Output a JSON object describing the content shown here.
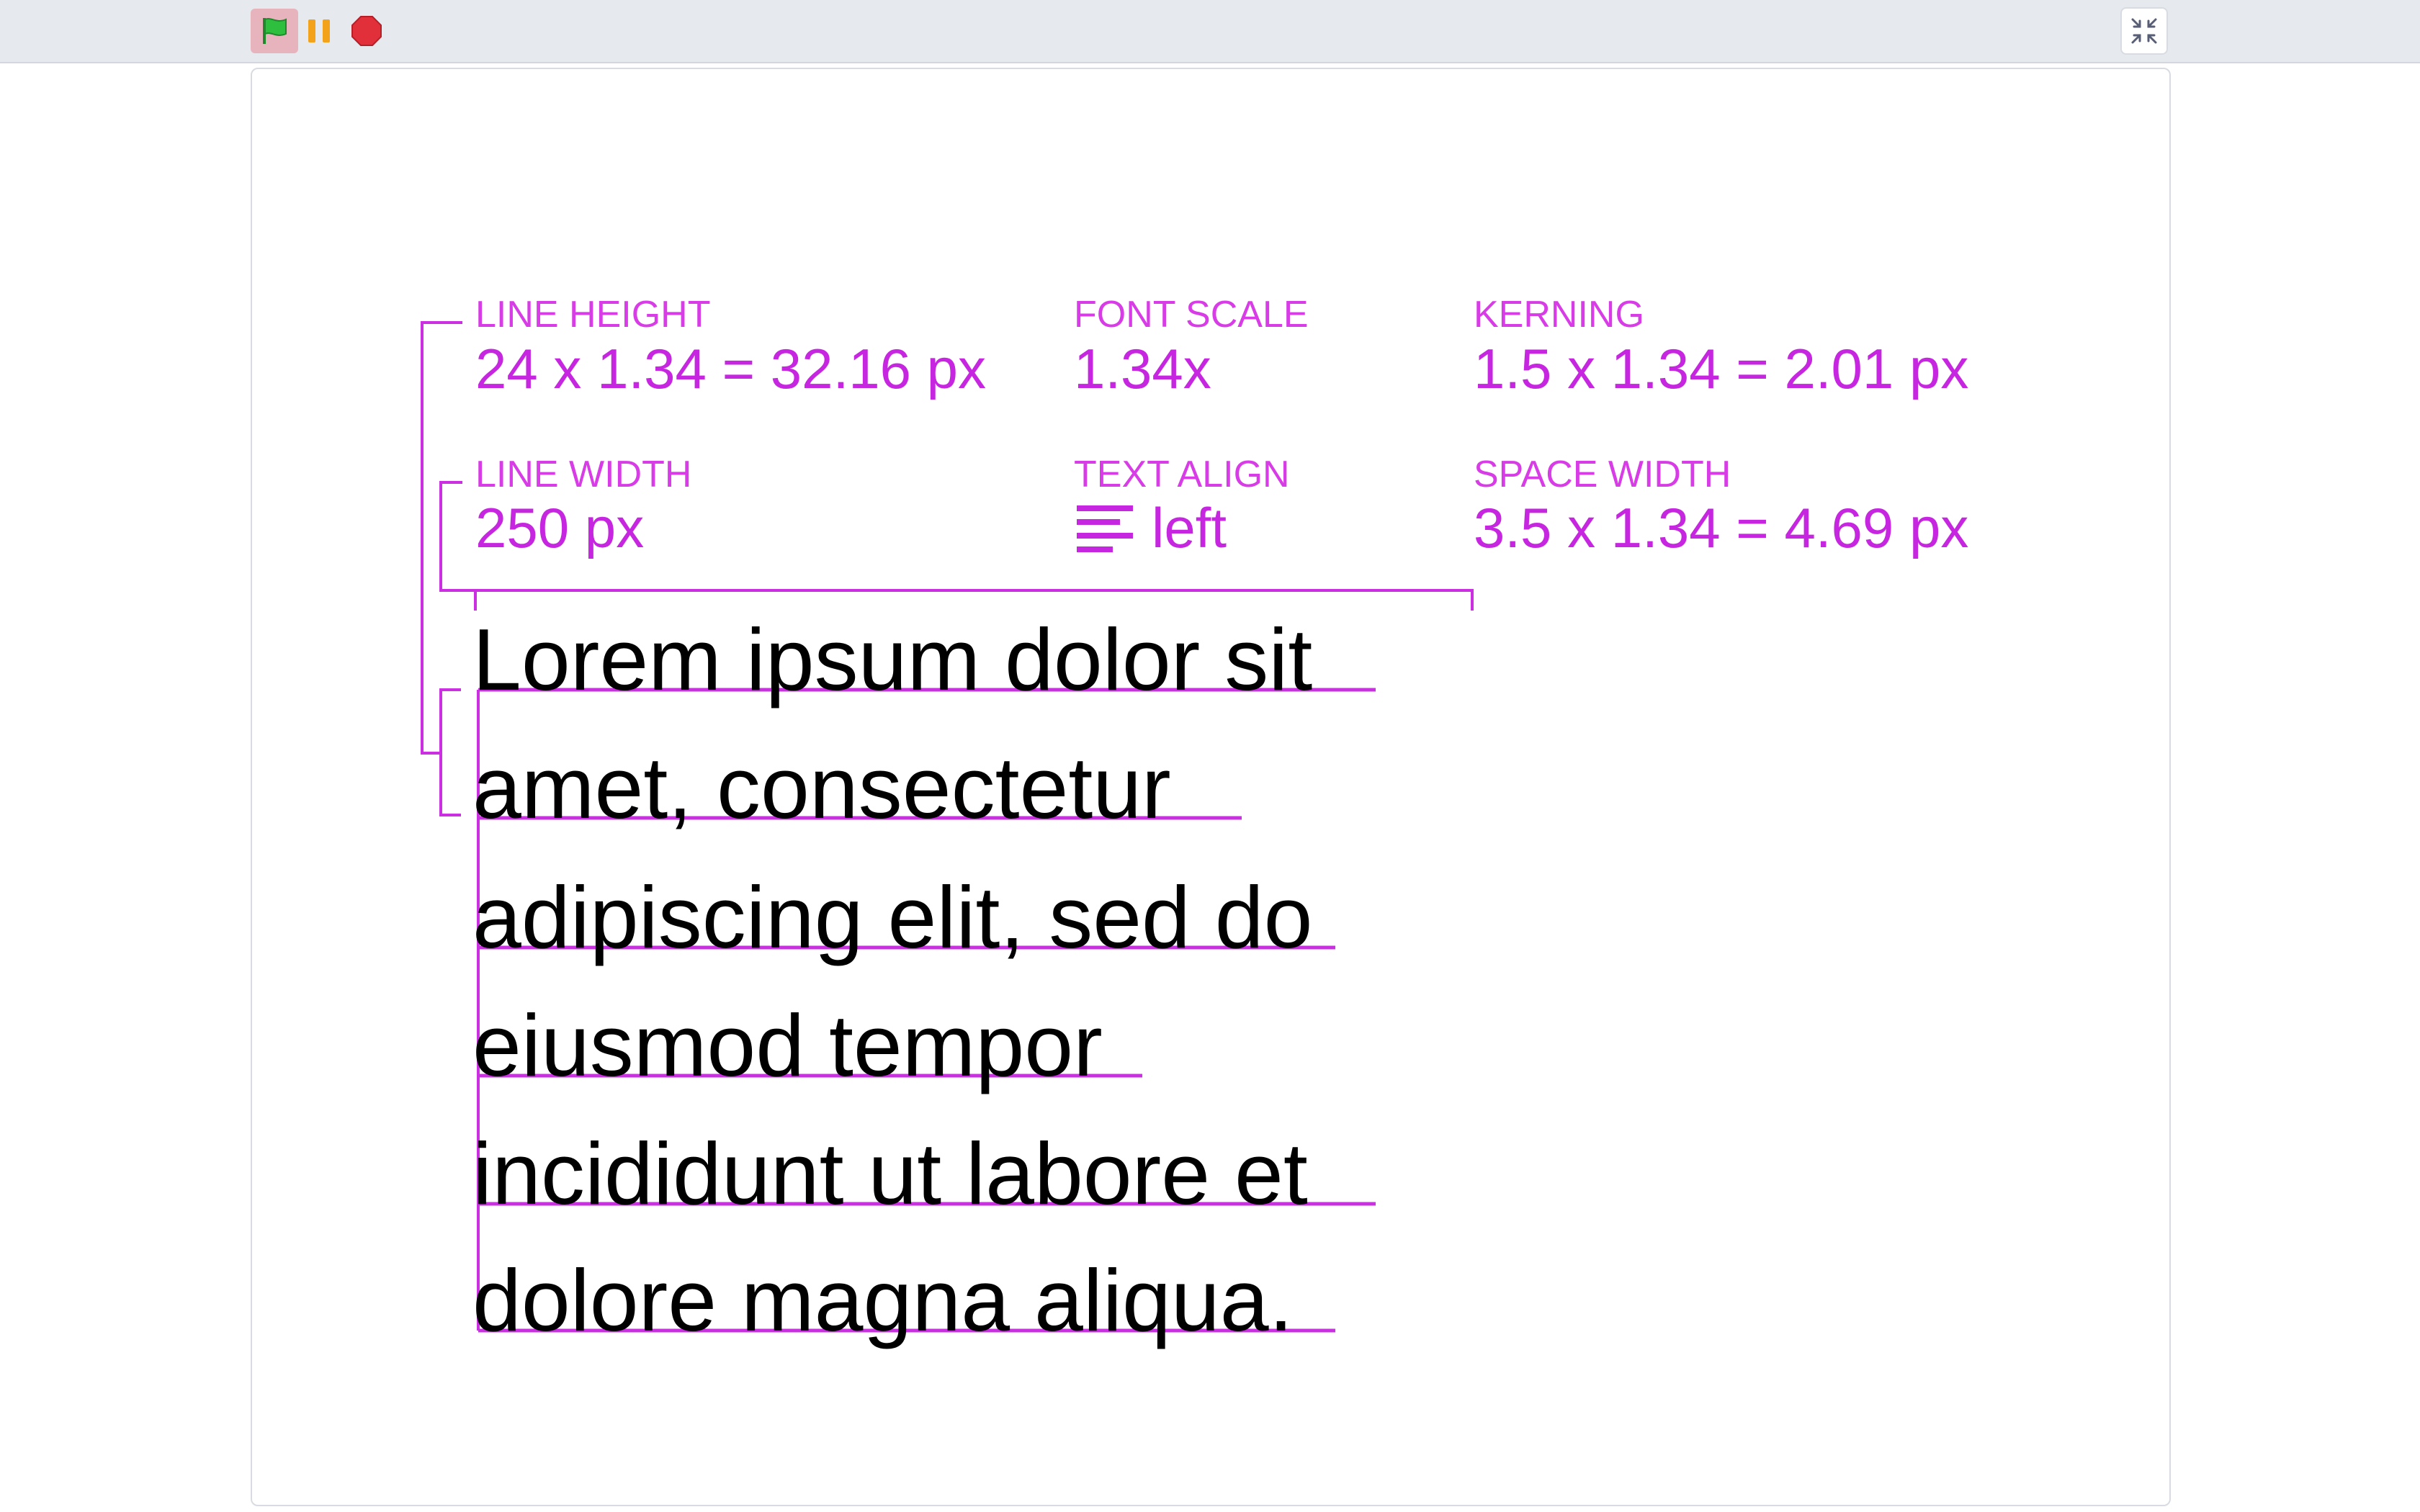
{
  "toolbar": {
    "flag_icon": "green-flag-icon",
    "pause_icon": "pause-icon",
    "stop_icon": "stop-icon",
    "fullscreen_icon": "exit-fullscreen-icon",
    "colors": {
      "flag": "#2fbf3f",
      "pause": "#f2a31b",
      "stop": "#e2303b",
      "accent": "#cc2ee2"
    }
  },
  "stage": {
    "metrics": {
      "line_height": {
        "label": "LINE HEIGHT",
        "value": "24 x 1.34 = 32.16 px"
      },
      "font_scale": {
        "label": "FONT SCALE",
        "value": "1.34x"
      },
      "kerning": {
        "label": "KERNING",
        "value": "1.5 x 1.34 = 2.01 px"
      },
      "line_width": {
        "label": "LINE WIDTH",
        "value": "250 px"
      },
      "text_align": {
        "label": "TEXT ALIGN",
        "value": "left",
        "icon": "align-left-icon"
      },
      "space_width": {
        "label": "SPACE WIDTH",
        "value": "3.5 x 1.34 = 4.69 px"
      }
    },
    "sample_lines": [
      "Lorem ipsum dolor sit",
      "amet, consectetur",
      "adipiscing elit, sed do",
      "eiusmod tempor",
      "incididunt ut labore et",
      "dolore magna aliqua."
    ]
  }
}
